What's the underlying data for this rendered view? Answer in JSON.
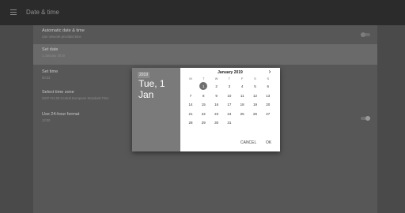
{
  "appbar": {
    "title": "Date & time",
    "menu_icon": "menu-icon"
  },
  "settings": [
    {
      "title": "Automatic date & time",
      "summary": "Use network-provided time",
      "toggle": "off"
    },
    {
      "title": "Set date",
      "summary": "1 January 2019",
      "highlight": true
    },
    {
      "title": "Set time",
      "summary": "00:33"
    },
    {
      "title": "Select time zone",
      "summary": "GMT+01:00 Central European Standard Time"
    },
    {
      "title": "Use 24-hour format",
      "summary": "13:00",
      "toggle": "on"
    }
  ],
  "dialog": {
    "year": "2019",
    "date_line1": "Tue, 1",
    "date_line2": "Jan",
    "month": "January 2019",
    "next_icon": "chevron-right-icon",
    "weekdays": [
      "M",
      "T",
      "W",
      "T",
      "F",
      "S",
      "S"
    ],
    "selected_day": "1",
    "weeks": [
      [
        "",
        "1",
        "2",
        "3",
        "4",
        "5",
        "6"
      ],
      [
        "7",
        "8",
        "9",
        "10",
        "11",
        "12",
        "13"
      ],
      [
        "14",
        "15",
        "16",
        "17",
        "18",
        "19",
        "20"
      ],
      [
        "21",
        "22",
        "23",
        "24",
        "25",
        "26",
        "27"
      ],
      [
        "28",
        "29",
        "30",
        "31",
        "",
        "",
        ""
      ]
    ],
    "cancel_label": "CANCEL",
    "ok_label": "OK"
  }
}
